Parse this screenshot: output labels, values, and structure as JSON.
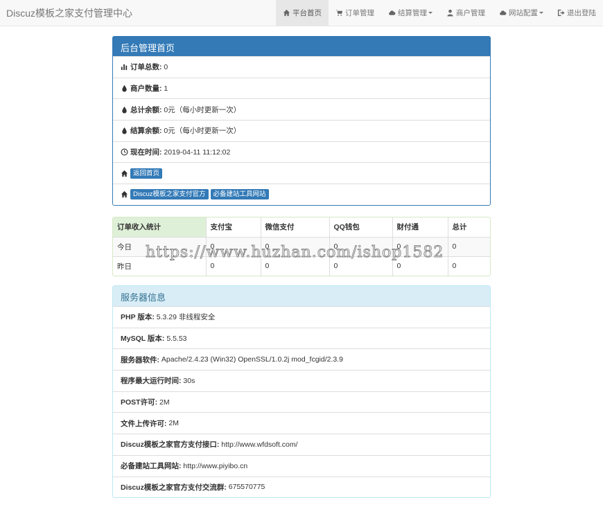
{
  "brand": "Discuz模板之家支付管理中心",
  "nav": [
    {
      "label": "平台首页",
      "icon": "home-icon"
    },
    {
      "label": "订单管理",
      "icon": "cart-icon"
    },
    {
      "label": "结算管理",
      "icon": "cloud-icon"
    },
    {
      "label": "商户管理",
      "icon": "user-icon"
    },
    {
      "label": "网站配置",
      "icon": "cloud-icon"
    },
    {
      "label": "退出登陆",
      "icon": "logout-icon"
    }
  ],
  "admin_panel": {
    "title": "后台管理首页",
    "rows": [
      {
        "label": "订单总数:",
        "value": "0"
      },
      {
        "label": "商户数量:",
        "value": "1"
      },
      {
        "label": "总计余额:",
        "value": "0元（每小时更新一次）"
      },
      {
        "label": "结算余额:",
        "value": "0元（每小时更新一次）"
      },
      {
        "label": "现在时间:",
        "value": " 2019-04-11 11:12:02"
      }
    ],
    "back_home": "返回首页",
    "links": [
      "Discuz模板之家支付官方",
      "必备建站工具网站"
    ]
  },
  "stats": {
    "headers": [
      "订单收入统计",
      "支付宝",
      "微信支付",
      "QQ钱包",
      "财付通",
      "总计"
    ],
    "rows": [
      [
        "今日",
        "0",
        "0",
        "0",
        "0",
        "0"
      ],
      [
        "昨日",
        "0",
        "0",
        "0",
        "0",
        "0"
      ]
    ]
  },
  "server_panel": {
    "title": "服务器信息",
    "rows": [
      {
        "label": "PHP 版本:",
        "value": "5.3.29 非线程安全"
      },
      {
        "label": "MySQL 版本:",
        "value": "5.5.53"
      },
      {
        "label": "服务器软件:",
        "value": "Apache/2.4.23 (Win32) OpenSSL/1.0.2j mod_fcgid/2.3.9"
      },
      {
        "label": "程序最大运行时间:",
        "value": "30s"
      },
      {
        "label": "POST许可:",
        "value": "2M"
      },
      {
        "label": "文件上传许可:",
        "value": "2M"
      },
      {
        "label": "Discuz模板之家官方支付接口:",
        "value": "http://www.wfdsoft.com/"
      },
      {
        "label": "必备建站工具网站:",
        "value": "http://www.piyibo.cn"
      },
      {
        "label": "Discuz模板之家官方支付交流群:",
        "value": "675570775"
      }
    ]
  },
  "watermark": "https://www.huzhan.com/ishop1582"
}
